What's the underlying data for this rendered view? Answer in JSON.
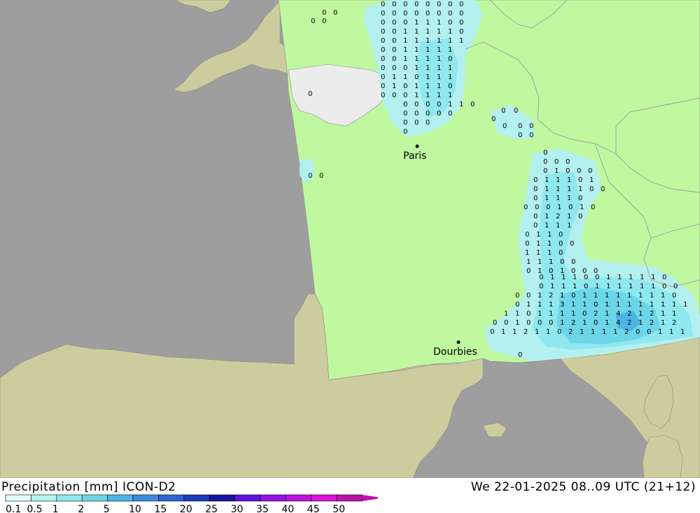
{
  "header": {
    "title": "Precipitation [mm] ICON-D2",
    "run_time": "We 22-01-2025 08..09 UTC (21+12)"
  },
  "legend": {
    "ticks": [
      "0.1",
      "0.5",
      "1",
      "2",
      "5",
      "10",
      "15",
      "20",
      "25",
      "30",
      "35",
      "40",
      "45",
      "50"
    ],
    "colors": [
      "#e0fcfc",
      "#b4f4f4",
      "#8ee8ee",
      "#6cd6e8",
      "#4cb4e4",
      "#3c8ce0",
      "#2c64d4",
      "#1c3cbc",
      "#1414a4",
      "#6010e0",
      "#9410e4",
      "#c010e0",
      "#e010dc",
      "#c010b0"
    ]
  },
  "colors": {
    "sea": "#9e9e9e",
    "land_outside": "#cccc9e",
    "model_domain": "#c0f8a0",
    "no_data": "#ececec",
    "rain_light": "#b4f0f0",
    "rain_moderate": "#6cd6e8",
    "rain_heavy": "#4cb4e4",
    "border": "#999999"
  },
  "cities": [
    {
      "name": "Paris",
      "lat": 48.85,
      "lon": 2.35
    },
    {
      "name": "Dourbies",
      "lat": 44.08,
      "lon": 3.45
    }
  ]
}
